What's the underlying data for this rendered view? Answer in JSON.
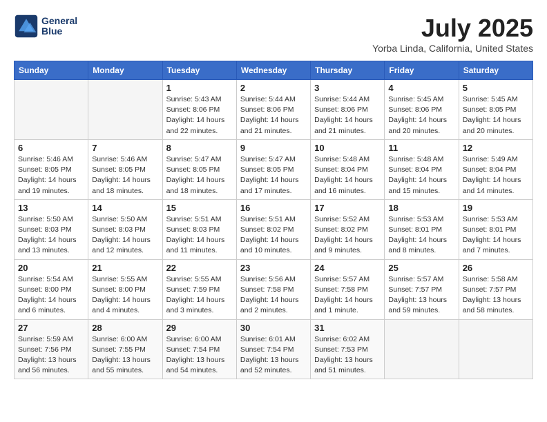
{
  "header": {
    "logo_line1": "General",
    "logo_line2": "Blue",
    "month": "July 2025",
    "location": "Yorba Linda, California, United States"
  },
  "weekdays": [
    "Sunday",
    "Monday",
    "Tuesday",
    "Wednesday",
    "Thursday",
    "Friday",
    "Saturday"
  ],
  "weeks": [
    [
      {
        "day": "",
        "info": ""
      },
      {
        "day": "",
        "info": ""
      },
      {
        "day": "1",
        "info": "Sunrise: 5:43 AM\nSunset: 8:06 PM\nDaylight: 14 hours\nand 22 minutes."
      },
      {
        "day": "2",
        "info": "Sunrise: 5:44 AM\nSunset: 8:06 PM\nDaylight: 14 hours\nand 21 minutes."
      },
      {
        "day": "3",
        "info": "Sunrise: 5:44 AM\nSunset: 8:06 PM\nDaylight: 14 hours\nand 21 minutes."
      },
      {
        "day": "4",
        "info": "Sunrise: 5:45 AM\nSunset: 8:06 PM\nDaylight: 14 hours\nand 20 minutes."
      },
      {
        "day": "5",
        "info": "Sunrise: 5:45 AM\nSunset: 8:05 PM\nDaylight: 14 hours\nand 20 minutes."
      }
    ],
    [
      {
        "day": "6",
        "info": "Sunrise: 5:46 AM\nSunset: 8:05 PM\nDaylight: 14 hours\nand 19 minutes."
      },
      {
        "day": "7",
        "info": "Sunrise: 5:46 AM\nSunset: 8:05 PM\nDaylight: 14 hours\nand 18 minutes."
      },
      {
        "day": "8",
        "info": "Sunrise: 5:47 AM\nSunset: 8:05 PM\nDaylight: 14 hours\nand 18 minutes."
      },
      {
        "day": "9",
        "info": "Sunrise: 5:47 AM\nSunset: 8:05 PM\nDaylight: 14 hours\nand 17 minutes."
      },
      {
        "day": "10",
        "info": "Sunrise: 5:48 AM\nSunset: 8:04 PM\nDaylight: 14 hours\nand 16 minutes."
      },
      {
        "day": "11",
        "info": "Sunrise: 5:48 AM\nSunset: 8:04 PM\nDaylight: 14 hours\nand 15 minutes."
      },
      {
        "day": "12",
        "info": "Sunrise: 5:49 AM\nSunset: 8:04 PM\nDaylight: 14 hours\nand 14 minutes."
      }
    ],
    [
      {
        "day": "13",
        "info": "Sunrise: 5:50 AM\nSunset: 8:03 PM\nDaylight: 14 hours\nand 13 minutes."
      },
      {
        "day": "14",
        "info": "Sunrise: 5:50 AM\nSunset: 8:03 PM\nDaylight: 14 hours\nand 12 minutes."
      },
      {
        "day": "15",
        "info": "Sunrise: 5:51 AM\nSunset: 8:03 PM\nDaylight: 14 hours\nand 11 minutes."
      },
      {
        "day": "16",
        "info": "Sunrise: 5:51 AM\nSunset: 8:02 PM\nDaylight: 14 hours\nand 10 minutes."
      },
      {
        "day": "17",
        "info": "Sunrise: 5:52 AM\nSunset: 8:02 PM\nDaylight: 14 hours\nand 9 minutes."
      },
      {
        "day": "18",
        "info": "Sunrise: 5:53 AM\nSunset: 8:01 PM\nDaylight: 14 hours\nand 8 minutes."
      },
      {
        "day": "19",
        "info": "Sunrise: 5:53 AM\nSunset: 8:01 PM\nDaylight: 14 hours\nand 7 minutes."
      }
    ],
    [
      {
        "day": "20",
        "info": "Sunrise: 5:54 AM\nSunset: 8:00 PM\nDaylight: 14 hours\nand 6 minutes."
      },
      {
        "day": "21",
        "info": "Sunrise: 5:55 AM\nSunset: 8:00 PM\nDaylight: 14 hours\nand 4 minutes."
      },
      {
        "day": "22",
        "info": "Sunrise: 5:55 AM\nSunset: 7:59 PM\nDaylight: 14 hours\nand 3 minutes."
      },
      {
        "day": "23",
        "info": "Sunrise: 5:56 AM\nSunset: 7:58 PM\nDaylight: 14 hours\nand 2 minutes."
      },
      {
        "day": "24",
        "info": "Sunrise: 5:57 AM\nSunset: 7:58 PM\nDaylight: 14 hours\nand 1 minute."
      },
      {
        "day": "25",
        "info": "Sunrise: 5:57 AM\nSunset: 7:57 PM\nDaylight: 13 hours\nand 59 minutes."
      },
      {
        "day": "26",
        "info": "Sunrise: 5:58 AM\nSunset: 7:57 PM\nDaylight: 13 hours\nand 58 minutes."
      }
    ],
    [
      {
        "day": "27",
        "info": "Sunrise: 5:59 AM\nSunset: 7:56 PM\nDaylight: 13 hours\nand 56 minutes."
      },
      {
        "day": "28",
        "info": "Sunrise: 6:00 AM\nSunset: 7:55 PM\nDaylight: 13 hours\nand 55 minutes."
      },
      {
        "day": "29",
        "info": "Sunrise: 6:00 AM\nSunset: 7:54 PM\nDaylight: 13 hours\nand 54 minutes."
      },
      {
        "day": "30",
        "info": "Sunrise: 6:01 AM\nSunset: 7:54 PM\nDaylight: 13 hours\nand 52 minutes."
      },
      {
        "day": "31",
        "info": "Sunrise: 6:02 AM\nSunset: 7:53 PM\nDaylight: 13 hours\nand 51 minutes."
      },
      {
        "day": "",
        "info": ""
      },
      {
        "day": "",
        "info": ""
      }
    ]
  ]
}
